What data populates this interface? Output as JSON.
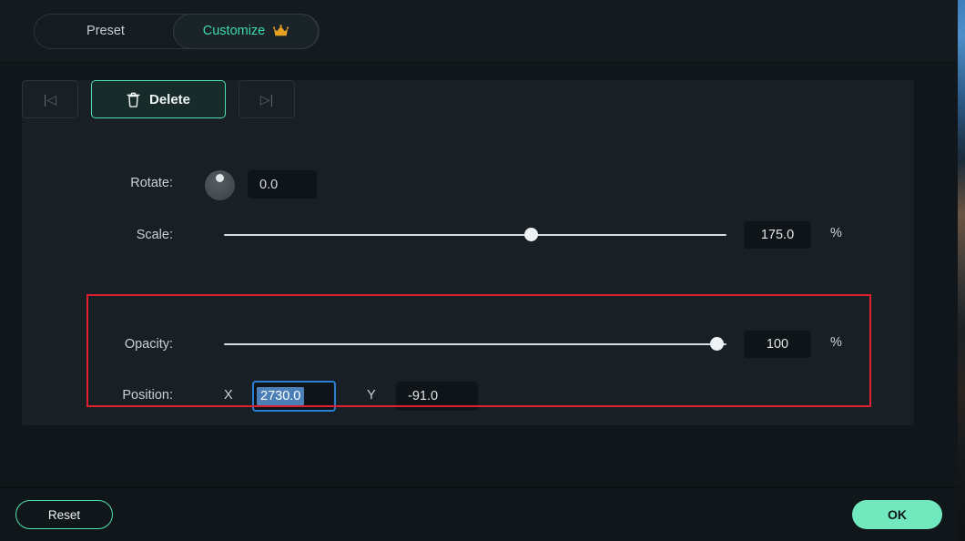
{
  "tabs": {
    "preset": {
      "label": "Preset",
      "selected": false
    },
    "customize": {
      "label": "Customize",
      "selected": true,
      "badge_icon": "crown-icon"
    }
  },
  "keyframe_nav": {
    "prev_icon": "skip-to-start-icon",
    "prev_glyph": "|◁",
    "next_icon": "skip-to-end-icon",
    "next_glyph": "▷|",
    "delete_label": "Delete",
    "delete_icon": "trash-icon"
  },
  "controls": {
    "rotate": {
      "label": "Rotate:",
      "value": "0.0",
      "knob_icon": "rotate-knob-icon"
    },
    "scale": {
      "label": "Scale:",
      "value": "175.0",
      "unit": "%",
      "fill_percent": 61
    },
    "position": {
      "label": "Position:",
      "x_axis_label": "X",
      "x_value": "2730.0",
      "y_axis_label": "Y",
      "y_value": "-91.0"
    },
    "opacity": {
      "label": "Opacity:",
      "value": "100",
      "unit": "%",
      "fill_percent": 98
    }
  },
  "footer": {
    "reset_label": "Reset",
    "ok_label": "OK"
  },
  "colors": {
    "accent_green": "#4fe0b4",
    "ok_button": "#72e8bf",
    "annotation_red": "#e02030",
    "focus_blue": "#2a7fd4",
    "selection_blue": "#4a7fb8",
    "crown_gold": "#e8a020",
    "panel_bg": "#182025",
    "dialog_bg": "#141a1d"
  }
}
